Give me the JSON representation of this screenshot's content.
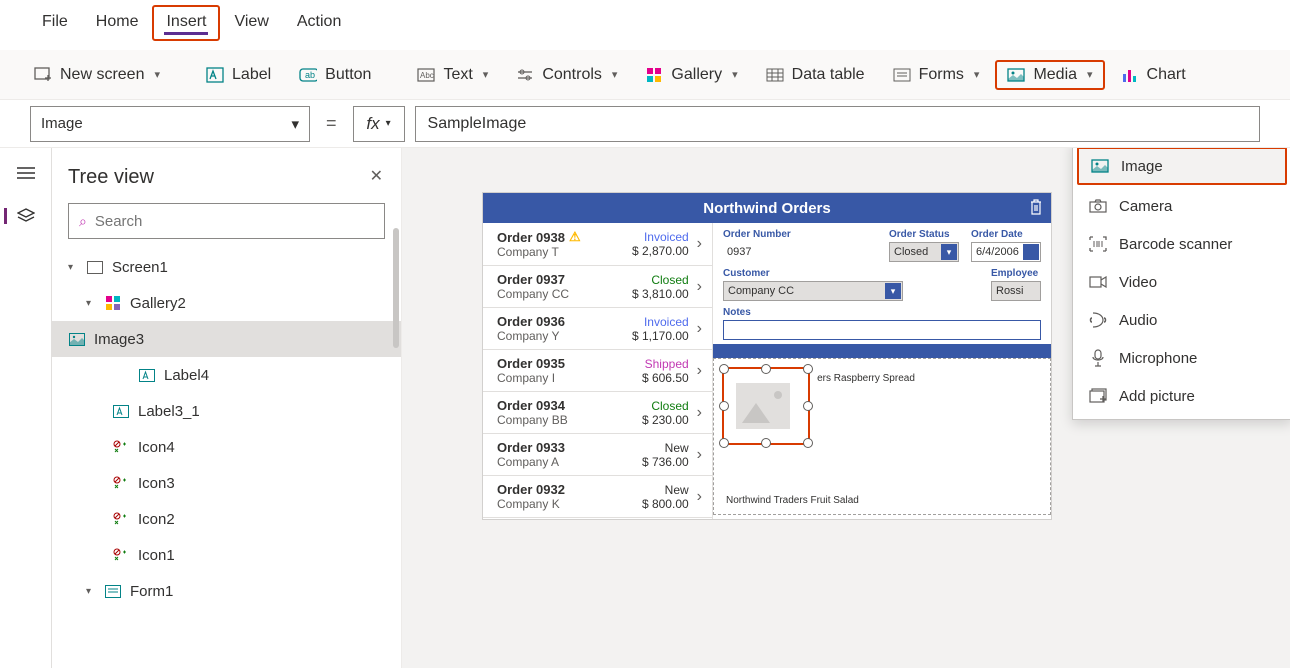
{
  "menu": {
    "file": "File",
    "home": "Home",
    "insert": "Insert",
    "view": "View",
    "action": "Action"
  },
  "ribbon": {
    "newScreen": "New screen",
    "label": "Label",
    "button": "Button",
    "text": "Text",
    "controls": "Controls",
    "gallery": "Gallery",
    "dataTable": "Data table",
    "forms": "Forms",
    "media": "Media",
    "charts": "Chart"
  },
  "property": {
    "name": "Image",
    "formula": "SampleImage"
  },
  "treePane": {
    "title": "Tree view",
    "searchPlaceholder": "Search"
  },
  "tree": {
    "screen": "Screen1",
    "gallery": "Gallery2",
    "image": "Image3",
    "label4": "Label4",
    "label3": "Label3_1",
    "icon4": "Icon4",
    "icon3": "Icon3",
    "icon2": "Icon2",
    "icon1": "Icon1",
    "form": "Form1"
  },
  "card": {
    "title": "Northwind Orders"
  },
  "orders": [
    {
      "id": "Order 0938",
      "warn": true,
      "company": "Company T",
      "status": "Invoiced",
      "statusCls": "invoiced",
      "price": "$ 2,870.00"
    },
    {
      "id": "Order 0937",
      "warn": false,
      "company": "Company CC",
      "status": "Closed",
      "statusCls": "closed",
      "price": "$ 3,810.00"
    },
    {
      "id": "Order 0936",
      "warn": false,
      "company": "Company Y",
      "status": "Invoiced",
      "statusCls": "invoiced",
      "price": "$ 1,170.00"
    },
    {
      "id": "Order 0935",
      "warn": false,
      "company": "Company I",
      "status": "Shipped",
      "statusCls": "shipped",
      "price": "$ 606.50"
    },
    {
      "id": "Order 0934",
      "warn": false,
      "company": "Company BB",
      "status": "Closed",
      "statusCls": "closed",
      "price": "$ 230.00"
    },
    {
      "id": "Order 0933",
      "warn": false,
      "company": "Company A",
      "status": "New",
      "statusCls": "new",
      "price": "$ 736.00"
    },
    {
      "id": "Order 0932",
      "warn": false,
      "company": "Company K",
      "status": "New",
      "statusCls": "new",
      "price": "$ 800.00"
    }
  ],
  "detail": {
    "orderNumberLabel": "Order Number",
    "orderNumber": "0937",
    "orderStatusLabel": "Order Status",
    "orderStatus": "Closed",
    "orderDateLabel": "Order Date",
    "orderDate": "6/4/2006",
    "customerLabel": "Customer",
    "customer": "Company CC",
    "employeeLabel": "Employee",
    "employee": "Rossi",
    "notesLabel": "Notes",
    "product1": "ers Raspberry Spread",
    "product2": "Northwind Traders Fruit Salad"
  },
  "mediaMenu": {
    "image": "Image",
    "camera": "Camera",
    "barcode": "Barcode scanner",
    "video": "Video",
    "audio": "Audio",
    "microphone": "Microphone",
    "addPicture": "Add picture"
  }
}
